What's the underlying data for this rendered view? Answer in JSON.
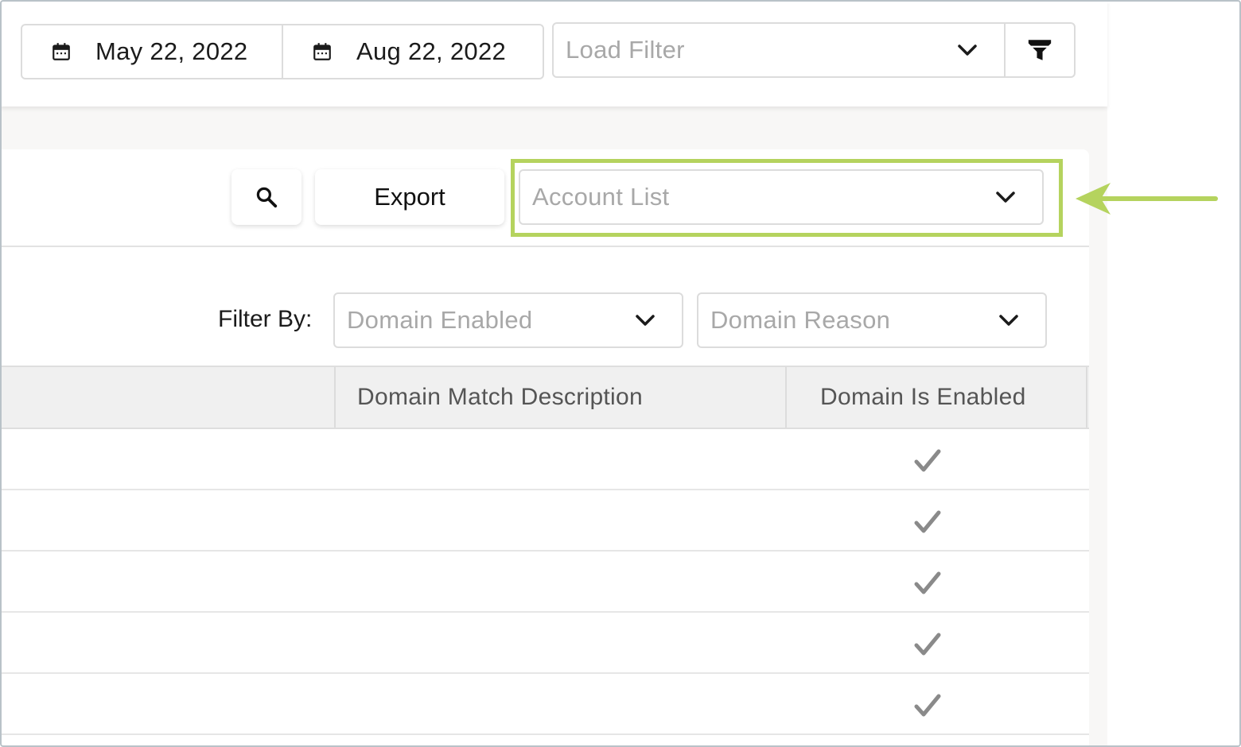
{
  "topbar": {
    "start_date": "May 22, 2022",
    "end_date": "Aug 22, 2022",
    "load_filter_placeholder": "Load Filter"
  },
  "toolbar": {
    "export_label": "Export",
    "account_list_placeholder": "Account List"
  },
  "filters": {
    "label": "Filter By:",
    "domain_enabled_placeholder": "Domain Enabled",
    "domain_reason_placeholder": "Domain Reason"
  },
  "table": {
    "columns": [
      "Domain Match Description",
      "Domain Is Enabled"
    ],
    "rows": [
      {
        "domain_is_enabled": true
      },
      {
        "domain_is_enabled": true
      },
      {
        "domain_is_enabled": true
      },
      {
        "domain_is_enabled": true
      },
      {
        "domain_is_enabled": true
      }
    ]
  },
  "icons": {
    "calendar": "calendar-icon",
    "chevron": "chevron-down-icon",
    "funnel": "funnel-icon",
    "search": "search-icon",
    "check": "checkmark-icon",
    "arrow": "arrow-left-icon"
  },
  "colors": {
    "highlight": "#b5d35e",
    "arrow": "#b5d35e",
    "placeholder": "#a8a8a8",
    "check": "#8a8a8a"
  }
}
